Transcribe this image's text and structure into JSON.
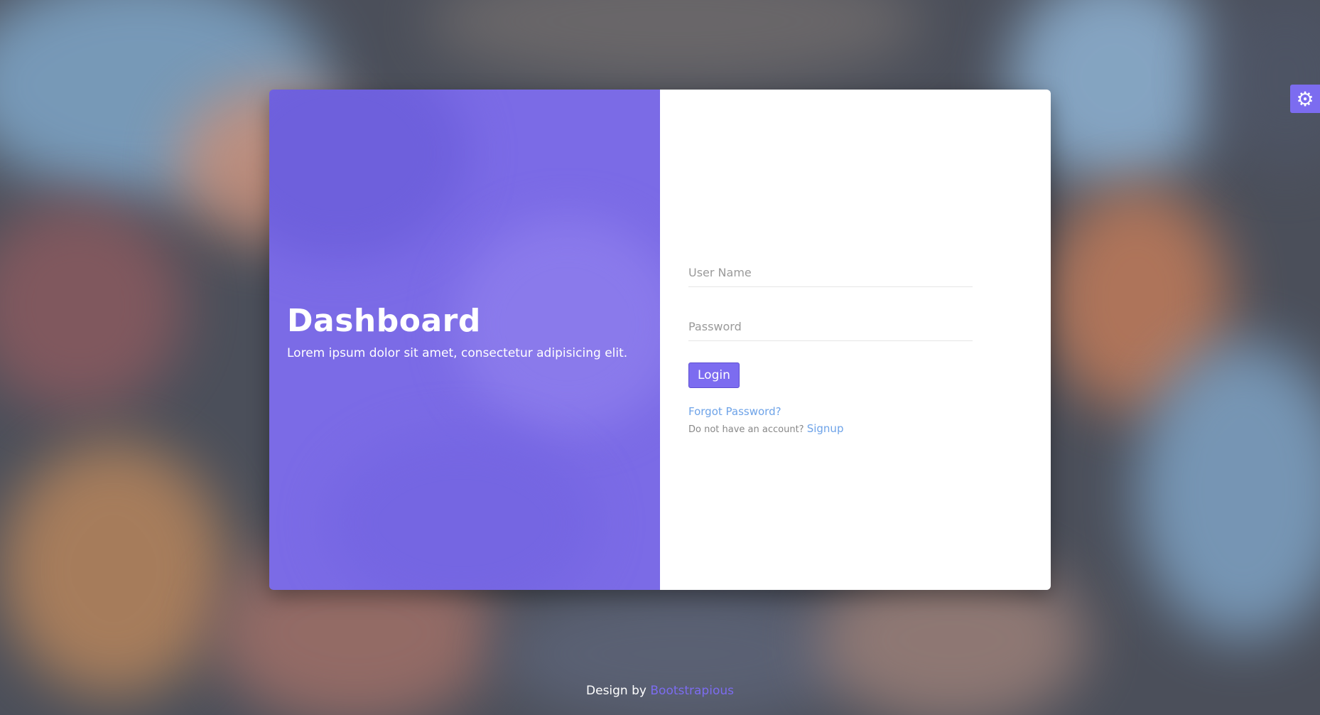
{
  "left_panel": {
    "title": "Dashboard",
    "subtitle": "Lorem ipsum dolor sit amet, consectetur adipisicing elit."
  },
  "form": {
    "username_placeholder": "User Name",
    "password_placeholder": "Password",
    "login_label": "Login",
    "forgot_label": "Forgot Password?",
    "no_account_text": "Do not have an account?",
    "signup_label": "Signup"
  },
  "footer": {
    "prefix": "Design by",
    "link_text": "Bootstrapious"
  },
  "settings": {
    "icon": "gear-icon"
  },
  "colors": {
    "accent": "#7c6cf0",
    "link": "#6ea3e8"
  }
}
